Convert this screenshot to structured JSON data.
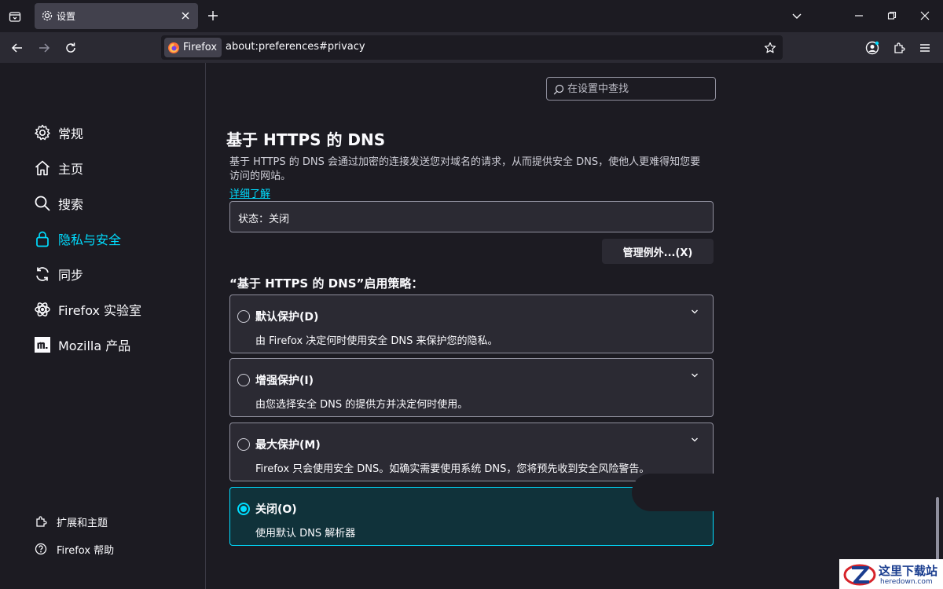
{
  "tab": {
    "title": "设置"
  },
  "urlbar": {
    "identity": "Firefox",
    "url": "about:preferences#privacy"
  },
  "sidebar": {
    "items": [
      {
        "label": "常规",
        "icon": "gear-icon"
      },
      {
        "label": "主页",
        "icon": "home-icon"
      },
      {
        "label": "搜索",
        "icon": "search-icon"
      },
      {
        "label": "隐私与安全",
        "icon": "lock-icon",
        "selected": true
      },
      {
        "label": "同步",
        "icon": "sync-icon"
      },
      {
        "label": "Firefox 实验室",
        "icon": "flask-icon"
      },
      {
        "label": "Mozilla 产品",
        "icon": "mozilla-icon"
      }
    ],
    "footer": [
      {
        "label": "扩展和主题",
        "icon": "puzzle-icon"
      },
      {
        "label": "Firefox 帮助",
        "icon": "help-icon"
      }
    ]
  },
  "search": {
    "placeholder": "在设置中查找"
  },
  "dns": {
    "heading": "基于 HTTPS 的 DNS",
    "description": "基于 HTTPS 的 DNS 会通过加密的连接发送您对域名的请求，从而提供安全 DNS，使他人更难得知您要访问的网站。",
    "learn_more": "详细了解",
    "status": "状态：关闭",
    "manage_button": "管理例外...(X)",
    "policy_title": "“基于 HTTPS 的 DNS”启用策略：",
    "options": [
      {
        "label": "默认保护(D)",
        "description": "由 Firefox 决定何时使用安全 DNS 来保护您的隐私。",
        "selected": false
      },
      {
        "label": "增强保护(I)",
        "description": "由您选择安全 DNS 的提供方并决定何时使用。",
        "selected": false
      },
      {
        "label": "最大保护(M)",
        "description": "Firefox 只会使用安全 DNS。如确实需要使用系统 DNS，您将预先收到安全风险警告。",
        "selected": false
      },
      {
        "label": "关闭(O)",
        "description": "使用默认 DNS 解析器",
        "selected": true
      }
    ]
  },
  "watermark": {
    "title": "这里下载站",
    "site": "heredown.com"
  },
  "colors": {
    "accent": "#00ddff",
    "background": "#1c1b22",
    "surface": "#2b2a33"
  }
}
